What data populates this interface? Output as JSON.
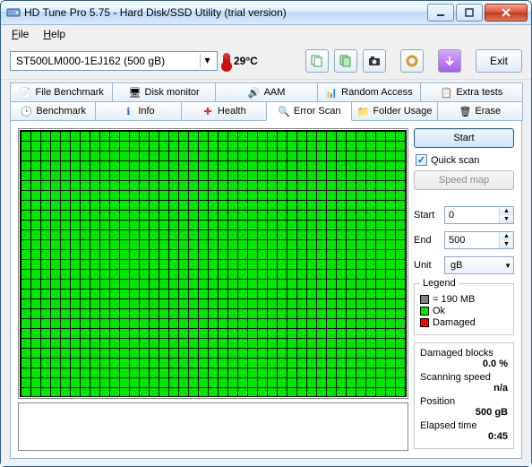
{
  "window": {
    "title": "HD Tune Pro 5.75 - Hard Disk/SSD Utility (trial version)"
  },
  "menu": {
    "file": "File",
    "help": "Help"
  },
  "toolbar": {
    "drive": "ST500LM000-1EJ162 (500 gB)",
    "temp": "29°C",
    "exit": "Exit"
  },
  "tabs_top": [
    {
      "label": "File Benchmark"
    },
    {
      "label": "Disk monitor"
    },
    {
      "label": "AAM"
    },
    {
      "label": "Random Access"
    },
    {
      "label": "Extra tests"
    }
  ],
  "tabs_bottom": [
    {
      "label": "Benchmark"
    },
    {
      "label": "Info"
    },
    {
      "label": "Health"
    },
    {
      "label": "Error Scan"
    },
    {
      "label": "Folder Usage"
    },
    {
      "label": "Erase"
    }
  ],
  "side": {
    "start_btn": "Start",
    "quick_scan": "Quick scan",
    "speed_map": "Speed map",
    "start_label": "Start",
    "start_val": "0",
    "end_label": "End",
    "end_val": "500",
    "unit_label": "Unit",
    "unit_val": "gB",
    "legend_title": "Legend",
    "legend_block": "= 190 MB",
    "legend_ok": "Ok",
    "legend_damaged": "Damaged",
    "damaged_blocks_label": "Damaged blocks",
    "damaged_blocks_val": "0.0 %",
    "scan_speed_label": "Scanning speed",
    "scan_speed_val": "n/a",
    "position_label": "Position",
    "position_val": "500 gB",
    "elapsed_label": "Elapsed time",
    "elapsed_val": "0:45"
  }
}
